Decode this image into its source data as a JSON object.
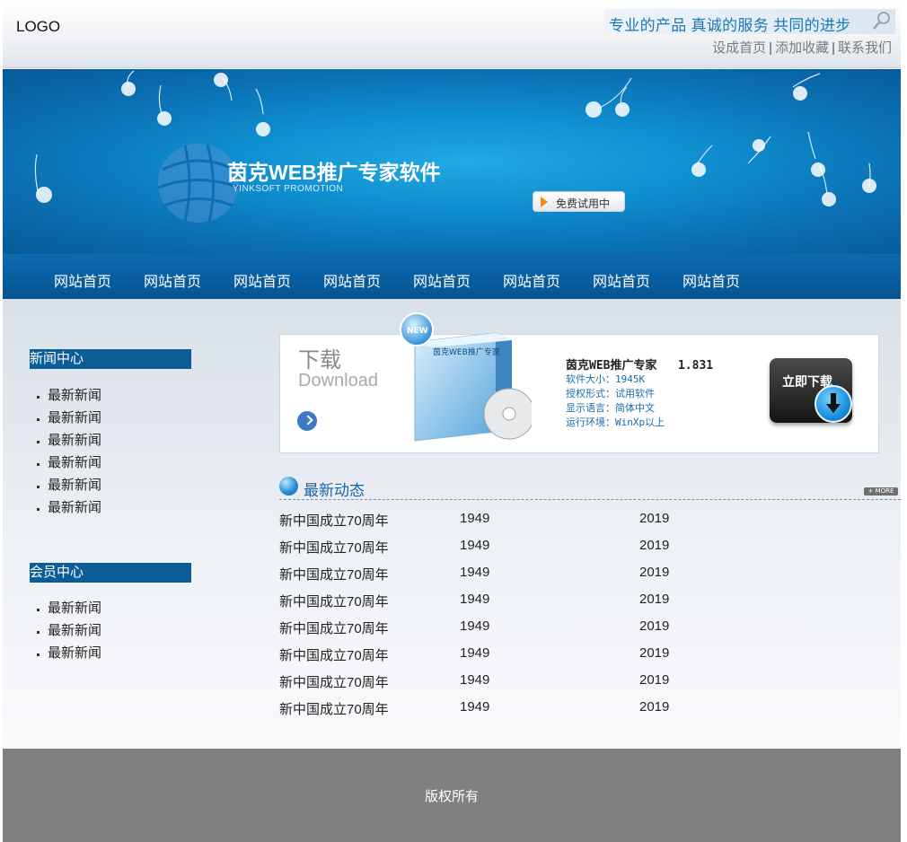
{
  "header": {
    "logo": "LOGO",
    "slogan": "专业的产品  真诚的服务  共同的进步",
    "links": [
      "设成首页",
      "添加收藏",
      "联系我们"
    ],
    "separator": "|"
  },
  "banner": {
    "title": "茵克WEB推广专家软件",
    "subtitle": "YINKSOFT PROMOTION",
    "trial_button": "免费试用中",
    "colors": {
      "sky": "#0f8fd0",
      "deep": "#085a98"
    }
  },
  "nav": {
    "items": [
      "网站首页",
      "网站首页",
      "网站首页",
      "网站首页",
      "网站首页",
      "网站首页",
      "网站首页",
      "网站首页"
    ]
  },
  "sidebar": {
    "news": {
      "title": "新闻中心",
      "items": [
        "最新新闻",
        "最新新闻",
        "最新新闻",
        "最新新闻",
        "最新新闻",
        "最新新闻"
      ]
    },
    "members": {
      "title": "会员中心",
      "items": [
        "最新新闻",
        "最新新闻",
        "最新新闻"
      ]
    }
  },
  "download": {
    "label_cn": "下载",
    "label_en": "Download",
    "box_badge": "NEW",
    "box_title": "茵克WEB推广专家",
    "product_name": "茵克WEB推广专家",
    "version": "1.831",
    "details": [
      "软件大小：1945K",
      "授权形式：试用软件",
      "显示语言：简体中文",
      "运行环境：WinXp以上"
    ],
    "button": "立即下载"
  },
  "news": {
    "title": "最新动态",
    "more": "+ MORE",
    "rows": [
      [
        "新中国成立70周年",
        "1949",
        "2019"
      ],
      [
        "新中国成立70周年",
        "1949",
        "2019"
      ],
      [
        "新中国成立70周年",
        "1949",
        "2019"
      ],
      [
        "新中国成立70周年",
        "1949",
        "2019"
      ],
      [
        "新中国成立70周年",
        "1949",
        "2019"
      ],
      [
        "新中国成立70周年",
        "1949",
        "2019"
      ],
      [
        "新中国成立70周年",
        "1949",
        "2019"
      ],
      [
        "新中国成立70周年",
        "1949",
        "2019"
      ]
    ]
  },
  "footer": {
    "text": "版权所有"
  }
}
